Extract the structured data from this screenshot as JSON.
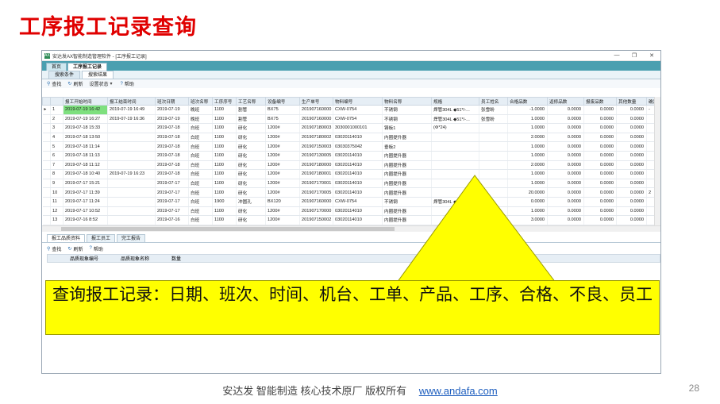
{
  "slide": {
    "title": "工序报工记录查询",
    "page_number": "28"
  },
  "window": {
    "app_icon": "AX",
    "title": "安达发AX智能制造管理软件 - [工序报工记录]",
    "controls": [
      "—",
      "❐",
      "✕"
    ]
  },
  "main_tabs": [
    {
      "label": "首页"
    },
    {
      "label": "工序报工记录"
    }
  ],
  "sub_tabs": [
    {
      "label": "搜索条件"
    },
    {
      "label": "搜索结果"
    }
  ],
  "toolbar": {
    "query": "查找",
    "refresh": "刷新",
    "settings": "设置状态",
    "help": "帮助"
  },
  "grid": {
    "columns": [
      "",
      "",
      "报工开始时间",
      "报工结束时间",
      "班次日期",
      "班次名称",
      "工序序号",
      "工艺名称",
      "设备编号",
      "生产单号",
      "物料编号",
      "物料名称",
      "规格",
      "员工姓名",
      "合格品数",
      "返修品数",
      "报废品数",
      "其他数量",
      "确定良品(A"
    ],
    "rows": [
      [
        "▸",
        "1",
        "2019-07-19 16:42",
        "2019-07-19 16:49",
        "2019-07-19",
        "晚班",
        "1100",
        "割管",
        "BX75",
        "201907160000",
        "CXW-0754",
        "不锈钢",
        "焊管304L ◆51*/-...",
        "张雪盼",
        "-1.0000",
        "0.0000",
        "0.0000",
        "0.0000",
        "-"
      ],
      [
        "",
        "2",
        "2019-07-19 16:27",
        "2019-07-19 16:36",
        "2019-07-19",
        "晚班",
        "1100",
        "割管",
        "BX75",
        "201907160000",
        "CXW-0754",
        "不锈钢",
        "焊管304L ◆51*/-...",
        "张雪盼",
        "1.0000",
        "0.0000",
        "0.0000",
        "0.0000",
        ""
      ],
      [
        "",
        "3",
        "2019-07-18 15:33",
        "",
        "2019-07-18",
        "白班",
        "1100",
        "研化",
        "1200#",
        "201907180003",
        "3030001000101",
        "铸板1",
        "(Φ*24)",
        "",
        "1.0000",
        "0.0000",
        "0.0000",
        "0.0000",
        ""
      ],
      [
        "",
        "4",
        "2019-07-18 13:50",
        "",
        "2019-07-18",
        "白班",
        "1100",
        "研化",
        "1200#",
        "201907180002",
        "03020114010",
        "内圈提升器",
        "",
        "",
        "2.0000",
        "0.0000",
        "0.0000",
        "0.0000",
        ""
      ],
      [
        "",
        "5",
        "2019-07-18 11:14",
        "",
        "2019-07-18",
        "白班",
        "1100",
        "研化",
        "1200#",
        "201907150003",
        "03030375042",
        "垂板2",
        "",
        "",
        "1.0000",
        "0.0000",
        "0.0000",
        "0.0000",
        ""
      ],
      [
        "",
        "6",
        "2019-07-18 11:13",
        "",
        "2019-07-18",
        "白班",
        "1100",
        "研化",
        "1200#",
        "201907130005",
        "03020114010",
        "内圈提升器",
        "",
        "",
        "1.0000",
        "0.0000",
        "0.0000",
        "0.0000",
        ""
      ],
      [
        "",
        "7",
        "2019-07-18 11:12",
        "",
        "2019-07-18",
        "白班",
        "1100",
        "研化",
        "1200#",
        "201907180000",
        "03020114010",
        "内圈提升器",
        "",
        "",
        "2.0000",
        "0.0000",
        "0.0000",
        "0.0000",
        ""
      ],
      [
        "",
        "8",
        "2019-07-18 10:40",
        "2019-07-19 16:23",
        "2019-07-18",
        "白班",
        "1100",
        "研化",
        "1200#",
        "201907180001",
        "03020114010",
        "内圈提升器",
        "",
        "",
        "1.0000",
        "0.0000",
        "0.0000",
        "0.0000",
        ""
      ],
      [
        "",
        "9",
        "2019-07-17 15:21",
        "",
        "2019-07-17",
        "白班",
        "1100",
        "研化",
        "1200#",
        "201907170001",
        "03020114010",
        "内圈提升器",
        "",
        "",
        "1.0000",
        "0.0000",
        "0.0000",
        "0.0000",
        ""
      ],
      [
        "",
        "10",
        "2019-07-17 11:39",
        "",
        "2019-07-17",
        "白班",
        "1100",
        "研化",
        "1200#",
        "201907170005",
        "03020114010",
        "内圈提升器",
        "",
        "",
        "20.0000",
        "0.0000",
        "0.0000",
        "0.0000",
        "2"
      ],
      [
        "",
        "11",
        "2019-07-17 11:24",
        "",
        "2019-07-17",
        "白班",
        "1900",
        "冲圆孔",
        "BX120",
        "201907160000",
        "CXW-0754",
        "不锈钢",
        "焊管304L ◆51*/-",
        "",
        "0.0000",
        "0.0000",
        "0.0000",
        "0.0000",
        ""
      ],
      [
        "",
        "12",
        "2019-07-17 10:52",
        "",
        "2019-07-17",
        "白班",
        "1100",
        "研化",
        "1200#",
        "201907170000",
        "03020114010",
        "内圈提升器",
        "",
        "",
        "1.0000",
        "0.0000",
        "0.0000",
        "0.0000",
        ""
      ],
      [
        "",
        "13",
        "2019-07-16 8:52",
        "",
        "2019-07-16",
        "白班",
        "1100",
        "研化",
        "1200#",
        "201907150002",
        "03020114010",
        "内圈提升器",
        "",
        "",
        "3.0000",
        "0.0000",
        "0.0000",
        "0.0000",
        ""
      ]
    ]
  },
  "lower_tabs": [
    {
      "label": "报工品质资料"
    },
    {
      "label": "报工员工"
    },
    {
      "label": "完工报告"
    }
  ],
  "lower_toolbar": {
    "query": "查找",
    "refresh": "刷新",
    "help": "帮助"
  },
  "lower_columns": [
    "品质现象编号",
    "品质现象名称",
    "数量"
  ],
  "callout": {
    "text": "查询报工记录：日期、班次、时间、机台、工单、产品、工序、合格、不良、员工"
  },
  "footer": {
    "text": "安达发   智能制造 核心技术原厂    版权所有",
    "link": "www.andafa.com"
  },
  "colors": {
    "title_red": "#e00000",
    "tab_bar": "#4a9fb0",
    "callout_yellow": "#ffff00",
    "highlight_green": "#7ee07e"
  }
}
